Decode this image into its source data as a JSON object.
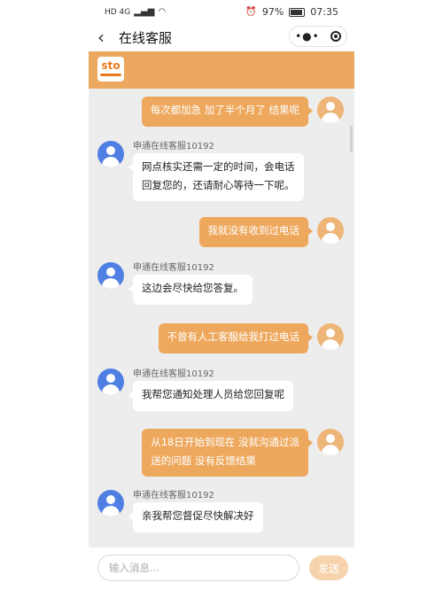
{
  "statusbar": {
    "left_icons": "HD 4G",
    "battery": "97%",
    "time": "07:35"
  },
  "nav": {
    "back_icon": "chevron-left-icon",
    "title": "在线客服"
  },
  "brand": {
    "logo_text": "sto"
  },
  "messages": [
    {
      "from": "user",
      "text": "每次都加急 加了半个月了 结果呢"
    },
    {
      "from": "agent",
      "sender": "申通在线客服10192",
      "text": [
        "网点核实还需一定的时间，会电话",
        "回复您的，还请耐心等待一下呢。"
      ]
    },
    {
      "from": "user",
      "text": "我就没有收到过电话"
    },
    {
      "from": "agent",
      "sender": "申通在线客服10192",
      "text": [
        "这边会尽快给您答复。"
      ]
    },
    {
      "from": "user",
      "text": "不曾有人工客服给我打过电话"
    },
    {
      "from": "agent",
      "sender": "申通在线客服10192",
      "text": [
        "我帮您通知处理人员给您回复呢"
      ]
    },
    {
      "from": "user",
      "text": [
        "从18日开始到现在 没就沟通过派",
        "送的问题 没有反馈结果"
      ]
    },
    {
      "from": "agent",
      "sender": "申通在线客服10192",
      "text": [
        "亲我帮您督促尽快解决好"
      ]
    }
  ],
  "input": {
    "placeholder": "输入消息...",
    "send_label": "发送"
  },
  "colors": {
    "accent": "#ECA85E",
    "agent_avatar": "#4F7FE3",
    "chat_bg": "#EDEDED"
  }
}
